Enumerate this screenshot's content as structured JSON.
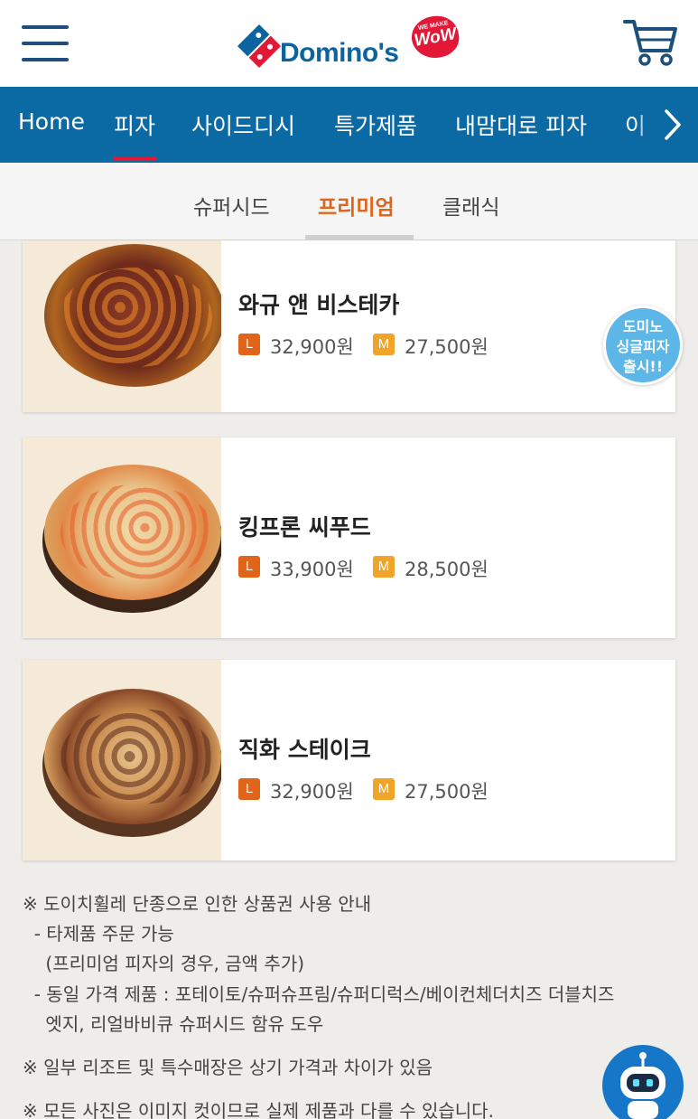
{
  "header": {
    "logo_text": "Domino's",
    "logo_badge_small": "WE MAKE",
    "logo_badge_big": "WoW",
    "menu_icon": "hamburger-menu-icon",
    "cart_icon": "shopping-cart-icon"
  },
  "nav": {
    "items": [
      "Home",
      "피자",
      "사이드디시",
      "특가제품",
      "내맘대로 피자",
      "이"
    ],
    "active_index": 1,
    "arrow": "›"
  },
  "subtabs": {
    "items": [
      "슈퍼시드",
      "프리미엄",
      "클래식"
    ],
    "active_index": 1
  },
  "products": [
    {
      "name": "와규 앤 비스테카",
      "size_l": "L",
      "price_l": "32,900원",
      "size_m": "M",
      "price_m": "27,500원"
    },
    {
      "name": "킹프론 씨푸드",
      "size_l": "L",
      "price_l": "33,900원",
      "size_m": "M",
      "price_m": "28,500원"
    },
    {
      "name": "직화 스테이크",
      "size_l": "L",
      "price_l": "32,900원",
      "size_m": "M",
      "price_m": "27,500원"
    }
  ],
  "float_badge": {
    "line1": "도미노",
    "line2": "싱글피자",
    "line3": "출시!!"
  },
  "notes": [
    "※ 도이치휠레 단종으로 인한 상품권 사용 안내",
    "  - 타제품 주문 가능",
    "    (프리미엄 피자의 경우, 금액 추가)",
    "  - 동일 가격 제품 : 포테이토/슈퍼슈프림/슈퍼디럭스/베이컨체더치즈 더블치즈",
    "    엣지, 리얼바비큐 슈퍼시드 함유 도우",
    "※ 일부 리조트 및 특수매장은 상기 가격과 차이가 있음",
    "※ 모든 사진은 이미지 컷이므로 실제 제품과 다를 수 있습니다."
  ],
  "colors": {
    "brand_blue": "#0b6aa3",
    "brand_red": "#e31837",
    "accent_orange": "#e0651b",
    "size_m_yellow": "#f0a52a"
  }
}
